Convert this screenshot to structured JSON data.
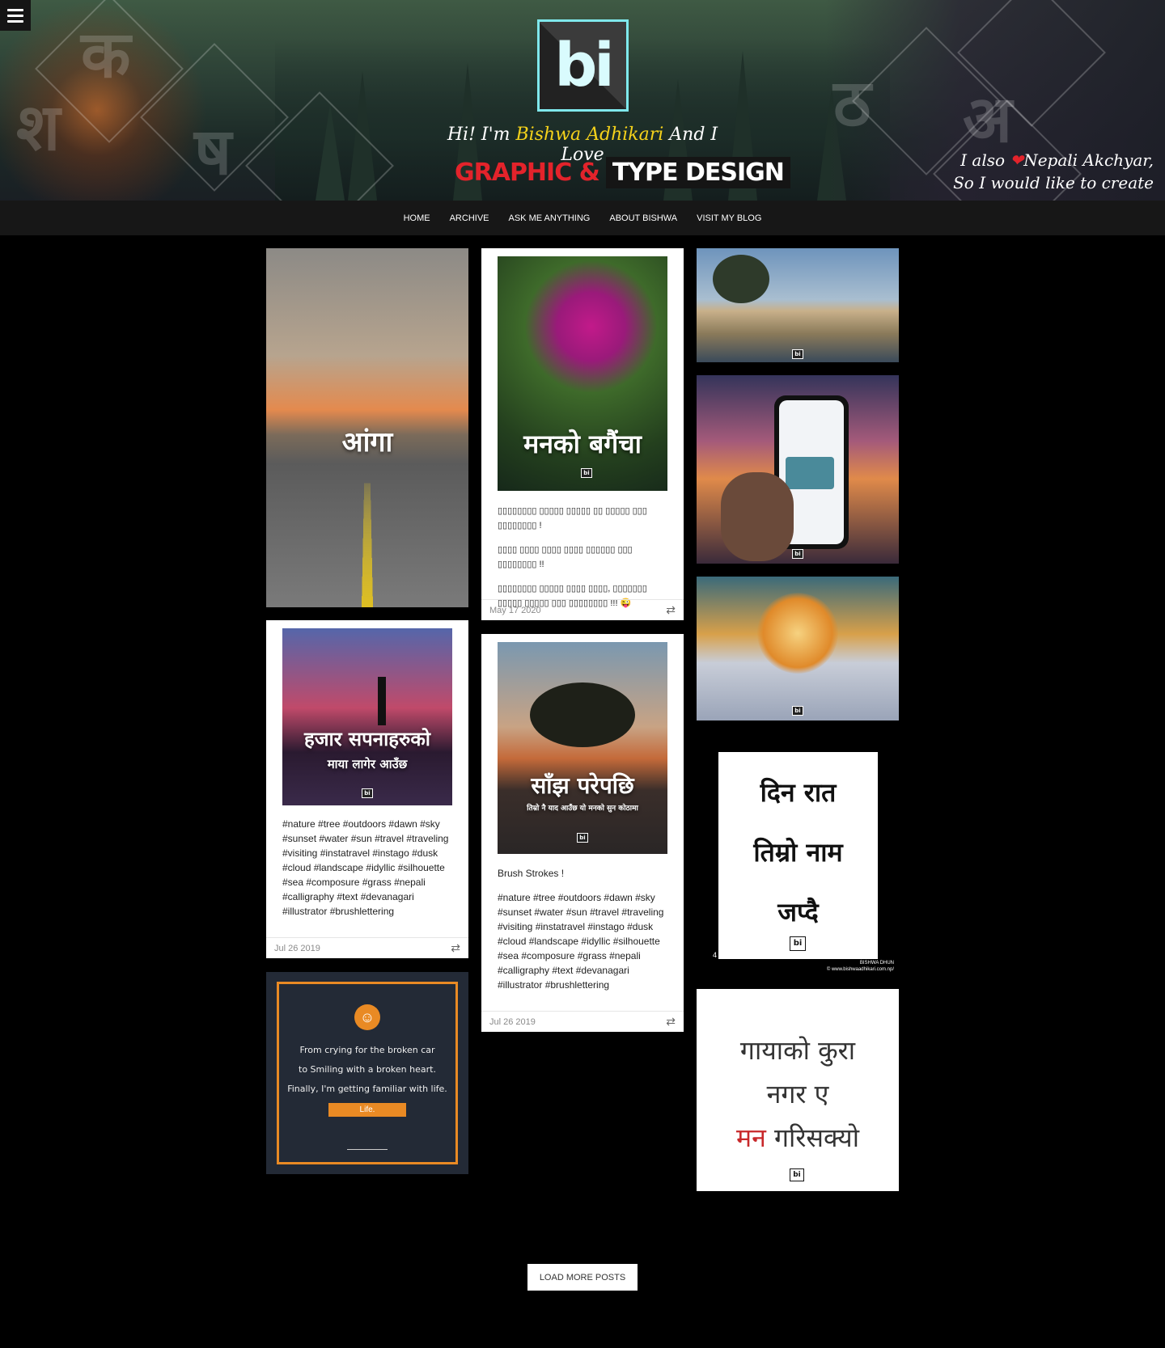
{
  "header": {
    "menu_icon": "hamburger-icon",
    "logo_mark": "bi",
    "tagline_pre": "Hi! I'm ",
    "tagline_name": "Bishwa Adhikari",
    "tagline_post": " And I Love",
    "headline_red": "GRAPHIC &",
    "headline_boxed": "TYPE DESIGN",
    "note_line1_pre": "I also ",
    "note_heart": "❤",
    "note_line1_post": "Nepali Akchyar,",
    "note_line2": "So I would like to create some."
  },
  "nav": {
    "items": [
      "HOME",
      "ARCHIVE",
      "ASK ME ANYTHING",
      "ABOUT BISHWA",
      "VISIT MY BLOG"
    ]
  },
  "posts": {
    "road": {
      "title": "आंगा"
    },
    "garden": {
      "title": "मनको बगैंचा",
      "lines": [
        "▯▯▯▯▯▯▯▯ ▯▯▯▯▯ ▯▯▯▯▯ ▯▯ ▯▯▯▯▯ ▯▯▯ ▯▯▯▯▯▯▯▯ !",
        "▯▯▯▯ ▯▯▯▯ ▯▯▯▯ ▯▯▯▯ ▯▯▯▯▯▯ ▯▯▯ ▯▯▯▯▯▯▯▯ !!",
        "▯▯▯▯▯▯▯▯ ▯▯▯▯▯ ▯▯▯▯ ▯▯▯▯, ▯▯▯▯▯▯▯ ▯▯▯▯▯ ▯▯▯▯▯ ▯▯▯ ▯▯▯▯▯▯▯▯ !!! 😜"
      ],
      "date": "May 17 2020"
    },
    "dreams": {
      "title_line1": "हजार सपनाहरुको",
      "title_line2": "माया लागेर आउँछ",
      "tags": "#nature #tree #outdoors #dawn #sky #sunset #water #sun #travel #traveling #visiting #instatravel #instago #dusk #cloud #landscape #idyllic #silhouette #sea #composure #grass #nepali #calligraphy #text #devanagari #illustrator #brushlettering",
      "date": "Jul 26 2019"
    },
    "tree": {
      "title": "साँझ परेपछि",
      "subtitle": "तिम्रो नै याद आउँछ यो मनको सुन कोठामा",
      "caption": "Brush Strokes !",
      "tags": "#nature #tree #outdoors #dawn #sky #sunset #water #sun #travel #traveling #visiting #instatravel #instago #dusk #cloud #landscape #idyllic #silhouette #sea #composure #grass #nepali #calligraphy #text #devanagari #illustrator #brushlettering",
      "date": "Jul 26 2019"
    },
    "life": {
      "line1": "From crying for the broken car",
      "line2": "to Smiling with a broken heart.",
      "line3": "Finally, I'm getting familiar with life.",
      "button": "Life."
    },
    "din_raat": {
      "line1": "दिन रात",
      "line2": "तिम्रो नाम",
      "line3": "जप्दै",
      "credit1": "BISHWA DHUN",
      "credit2": "© www.bishwaadhikari.com.np/",
      "counter": "4"
    },
    "gayako": {
      "line1": "गायाको कुरा",
      "line2": "नगर ए",
      "line3_red": "मन",
      "line3_rest": "गरिसक्यो"
    }
  },
  "footer": {
    "load_more": "LOAD MORE POSTS"
  },
  "colors": {
    "accent_red": "#e3232b",
    "accent_yellow": "#f5d21b",
    "logo_cyan": "#7fe8ec",
    "life_orange": "#e98a24"
  }
}
